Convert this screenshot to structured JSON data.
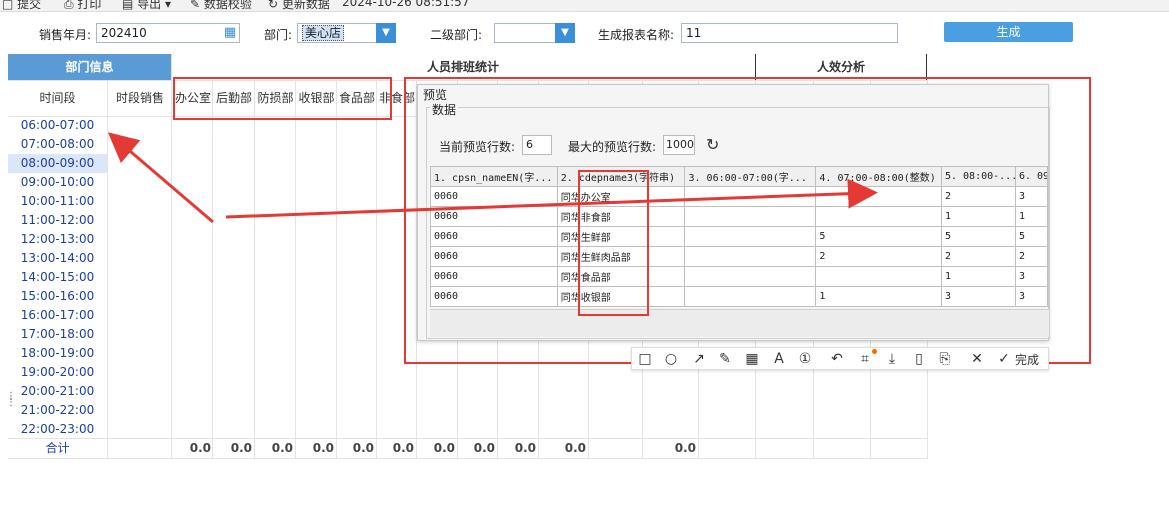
{
  "toolbar": {
    "submit": "提交",
    "print": "打印",
    "export": "导出",
    "validate": "数据校验",
    "refresh": "更新数据",
    "timestamp": "2024-10-26 08:51:57"
  },
  "params": {
    "month_label": "销售年月:",
    "month_value": "202410",
    "dept_label": "部门:",
    "dept_value": "美心店",
    "subdept_label": "二级部门:",
    "subdept_value": "",
    "report_name_label": "生成报表名称:",
    "report_name_value": "11",
    "generate": "生成"
  },
  "report": {
    "header_dept_info": "部门信息",
    "header_staff_stats": "人员排班统计",
    "header_efficiency": "人效分析",
    "col_timeslot": "时间段",
    "col_slot_sales": "时段销售",
    "dept_columns": [
      "办公室",
      "后勤部",
      "防损部",
      "收银部",
      "食品部",
      "非食部"
    ],
    "time_slots": [
      "06:00-07:00",
      "07:00-08:00",
      "08:00-09:00",
      "09:00-10:00",
      "10:00-11:00",
      "11:00-12:00",
      "12:00-13:00",
      "13:00-14:00",
      "14:00-15:00",
      "15:00-16:00",
      "16:00-17:00",
      "17:00-18:00",
      "18:00-19:00",
      "19:00-20:00",
      "20:00-21:00",
      "21:00-22:00",
      "22:00-23:00"
    ],
    "total_label": "合计",
    "totals": [
      "0.0",
      "0.0",
      "0.0",
      "0.0",
      "0.0",
      "0.0",
      "0.0",
      "0.0",
      "0.0",
      "0.0",
      "0.0"
    ]
  },
  "preview": {
    "title": "预览",
    "group_label": "数据",
    "current_rows_label": "当前预览行数:",
    "current_rows_value": "6",
    "max_rows_label": "最大的预览行数:",
    "max_rows_value": "1000",
    "columns": [
      "1. cpsn_nameEN(字...",
      "2. cdepname3(字符串)",
      "3. 06:00-07:00(字...",
      "4. 07:00-08:00(整数)",
      "5. 08:00-...",
      "6. 09"
    ],
    "rows": [
      [
        "0060",
        "同华办公室",
        "",
        "",
        "2",
        "3"
      ],
      [
        "0060",
        "同华非食部",
        "",
        "",
        "1",
        "1"
      ],
      [
        "0060",
        "同华生鲜部",
        "",
        "5",
        "5",
        "5"
      ],
      [
        "0060",
        "同华生鲜肉品部",
        "",
        "2",
        "2",
        "2"
      ],
      [
        "0060",
        "同华食品部",
        "",
        "",
        "1",
        "3"
      ],
      [
        "0060",
        "同华收银部",
        "",
        "1",
        "3",
        "3"
      ]
    ]
  },
  "annotation_toolbar": {
    "done": "完成",
    "icons": [
      "rectangle-icon",
      "ellipse-icon",
      "arrow-icon",
      "pen-icon",
      "mosaic-icon",
      "text-icon",
      "number-icon",
      "undo-icon",
      "ocr-icon",
      "download-icon",
      "pin-icon",
      "save-icon",
      "cancel-icon",
      "confirm-icon"
    ]
  },
  "colors": {
    "highlight_red": "#e53935",
    "header_blue": "#5b9bd5",
    "time_link": "#1a3fa0",
    "selected_row": "#dbe7f8"
  }
}
